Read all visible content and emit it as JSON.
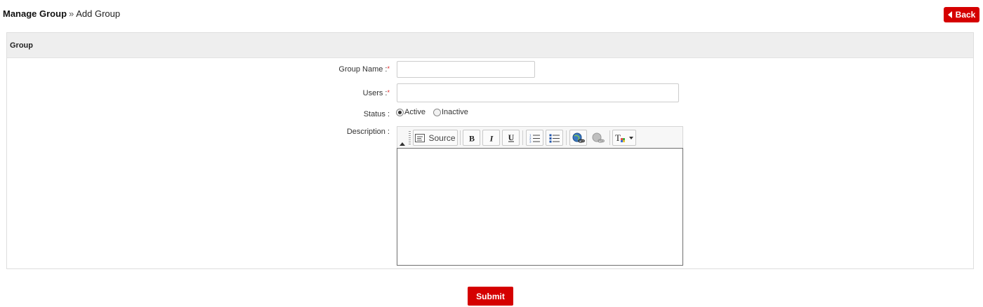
{
  "breadcrumb": {
    "parent": "Manage Group",
    "separator": "»",
    "current": "Add Group"
  },
  "back_button": {
    "label": "Back"
  },
  "panel": {
    "title": "Group"
  },
  "form": {
    "group_name": {
      "label": "Group Name :",
      "required_mark": "*",
      "value": "",
      "placeholder": ""
    },
    "users": {
      "label": "Users :",
      "required_mark": "*",
      "value": "",
      "placeholder": ""
    },
    "status": {
      "label": "Status :",
      "options": [
        {
          "label": "Active",
          "selected": true
        },
        {
          "label": "Inactive",
          "selected": false
        }
      ]
    },
    "description": {
      "label": "Description :",
      "toolbar": {
        "source_label": "Source",
        "buttons": [
          "source",
          "bold",
          "italic",
          "underline",
          "numbered-list",
          "bulleted-list",
          "link",
          "unlink",
          "remove-format"
        ]
      },
      "value": ""
    }
  },
  "submit_button": {
    "label": "Submit"
  },
  "colors": {
    "accent": "#d50000",
    "panel_header_bg": "#eeeeee",
    "required": "#e02020"
  }
}
